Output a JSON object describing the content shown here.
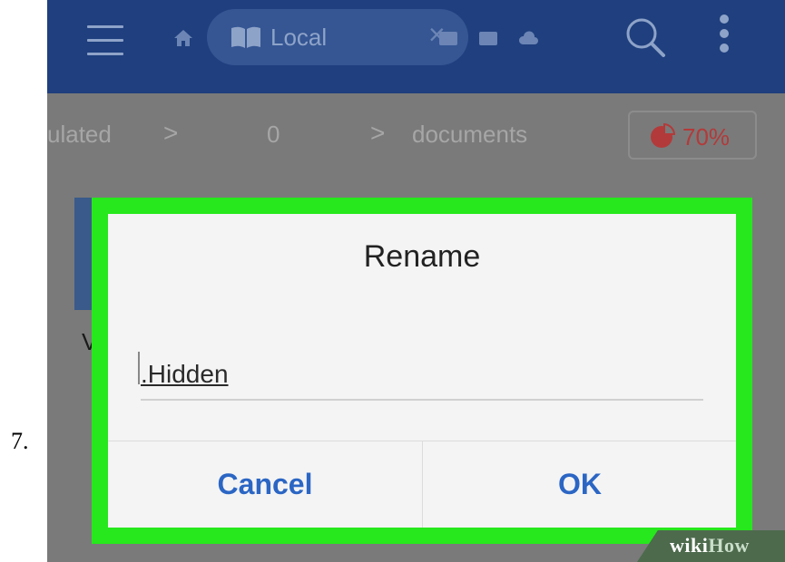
{
  "step": {
    "number": "7."
  },
  "appbar": {
    "tab_label": "Local",
    "close_glyph": "×",
    "icons": [
      "hamburger-icon",
      "home-icon",
      "book-icon",
      "close-icon",
      "window-icon",
      "window-icon",
      "cloud-icon",
      "search-icon",
      "more-vert-icon"
    ],
    "bar_color": "#1f3f7e"
  },
  "breadcrumb": {
    "items": [
      "ulated",
      "0",
      "documents"
    ],
    "separator": ">",
    "storage_percent": "70%",
    "storage_icon": "pie-chart-icon",
    "storage_color": "#b33a3a"
  },
  "background_list": {
    "file_label_fragment": "V"
  },
  "dialog": {
    "title": "Rename",
    "input_value": ".Hidden",
    "cancel_label": "Cancel",
    "ok_label": "OK",
    "frame_color": "#26e81c",
    "button_color": "#2b66c4"
  },
  "watermark": {
    "part1": "wiki",
    "part2": "How"
  }
}
